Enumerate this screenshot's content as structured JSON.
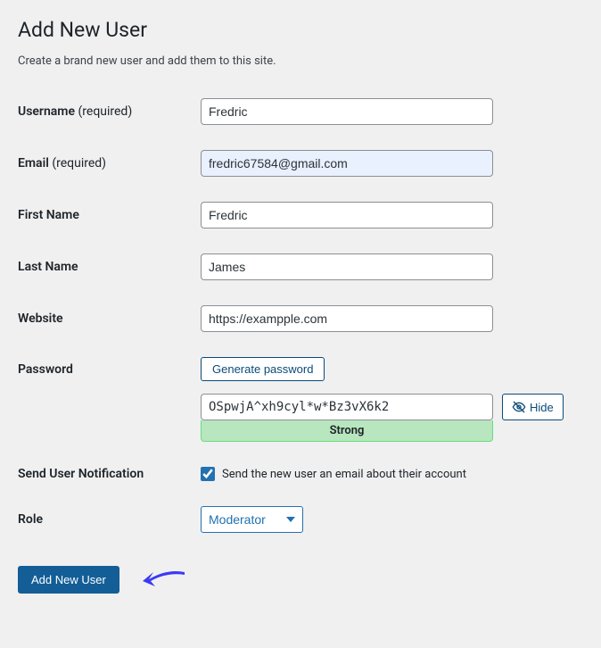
{
  "header": {
    "title": "Add New User",
    "description": "Create a brand new user and add them to this site."
  },
  "fields": {
    "username": {
      "label": "Username",
      "required_text": "(required)",
      "value": "Fredric"
    },
    "email": {
      "label": "Email",
      "required_text": "(required)",
      "value": "fredric67584@gmail.com"
    },
    "first_name": {
      "label": "First Name",
      "value": "Fredric"
    },
    "last_name": {
      "label": "Last Name",
      "value": "James"
    },
    "website": {
      "label": "Website",
      "value": "https://exampple.com"
    },
    "password": {
      "label": "Password",
      "generate_label": "Generate password",
      "value": "OSpwjA^xh9cyl*w*Bz3vX6k2",
      "hide_label": "Hide",
      "strength": "Strong"
    },
    "notification": {
      "label": "Send User Notification",
      "checked": true,
      "desc": "Send the new user an email about their account"
    },
    "role": {
      "label": "Role",
      "selected": "Moderator"
    }
  },
  "submit": {
    "label": "Add New User"
  }
}
